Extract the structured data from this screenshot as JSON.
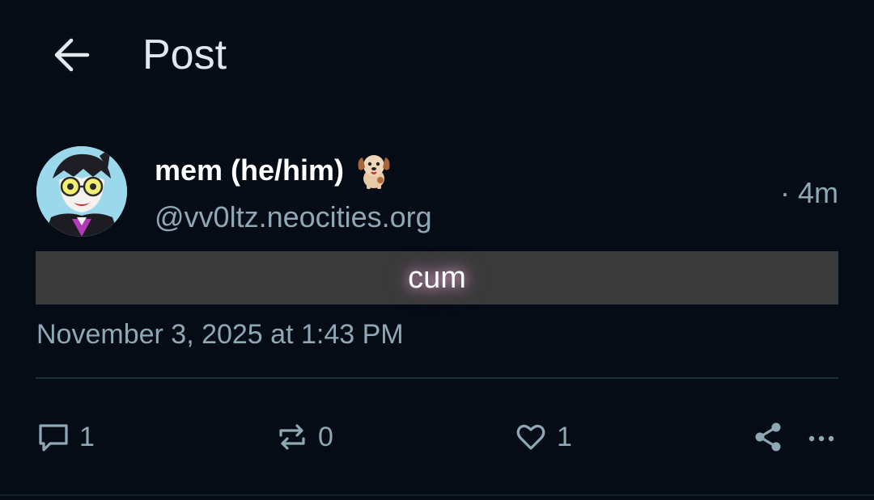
{
  "header": {
    "title": "Post",
    "back_icon": "arrow-left-icon"
  },
  "post": {
    "author": {
      "display_name": "mem (he/him)",
      "name_emoji_icon": "dog-face-icon",
      "handle": "@vv0ltz.neocities.org",
      "avatar_icon": "cartoon-avatar"
    },
    "relative_time": "· 4m",
    "content": "cum",
    "full_date": "November 3, 2025 at 1:43 PM",
    "actions": {
      "reply": {
        "icon": "reply-bubble-icon",
        "count": "1"
      },
      "repost": {
        "icon": "repost-icon",
        "count": "0"
      },
      "like": {
        "icon": "heart-icon",
        "count": "1"
      },
      "share": {
        "icon": "share-icon"
      },
      "more": {
        "icon": "more-horizontal-icon"
      }
    }
  },
  "colors": {
    "background": "#050c16",
    "muted_text": "#8ea8b6",
    "content_box": "#3a3a3a"
  }
}
